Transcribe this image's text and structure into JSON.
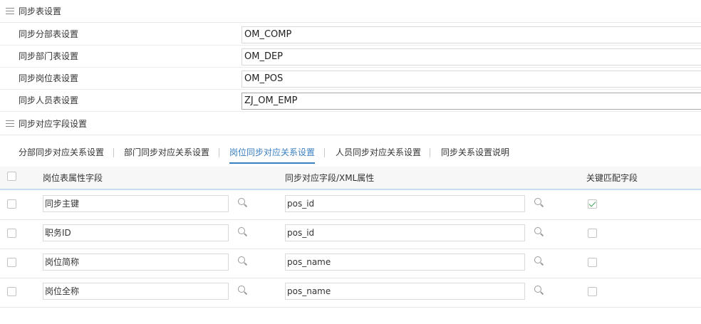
{
  "sections": {
    "sync_table": "同步表设置",
    "sync_field": "同步对应字段设置"
  },
  "table_settings": [
    {
      "label": "同步分部表设置",
      "value": "OM_COMP"
    },
    {
      "label": "同步部门表设置",
      "value": "OM_DEP"
    },
    {
      "label": "同步岗位表设置",
      "value": "OM_POS"
    },
    {
      "label": "同步人员表设置",
      "value": "ZJ_OM_EMP"
    }
  ],
  "tabs": [
    {
      "label": "分部同步对应关系设置",
      "active": false
    },
    {
      "label": "部门同步对应关系设置",
      "active": false
    },
    {
      "label": "岗位同步对应关系设置",
      "active": true
    },
    {
      "label": "人员同步对应关系设置",
      "active": false
    },
    {
      "label": "同步关系设置说明",
      "active": false
    }
  ],
  "grid": {
    "columns": {
      "attr": "岗位表属性字段",
      "mapping": "同步对应字段/XML属性",
      "key": "关键匹配字段"
    },
    "rows": [
      {
        "attr": "同步主键",
        "mapping": "pos_id",
        "key_checked": true
      },
      {
        "attr": "职务ID",
        "mapping": "pos_id",
        "key_checked": false
      },
      {
        "attr": "岗位简称",
        "mapping": "pos_name",
        "key_checked": false
      },
      {
        "attr": "岗位全称",
        "mapping": "pos_name",
        "key_checked": false
      }
    ]
  },
  "colors": {
    "accent": "#3a7fc1",
    "check": "#3aa657"
  },
  "icons": {
    "section": "menu-icon",
    "lookup": "search-icon"
  }
}
